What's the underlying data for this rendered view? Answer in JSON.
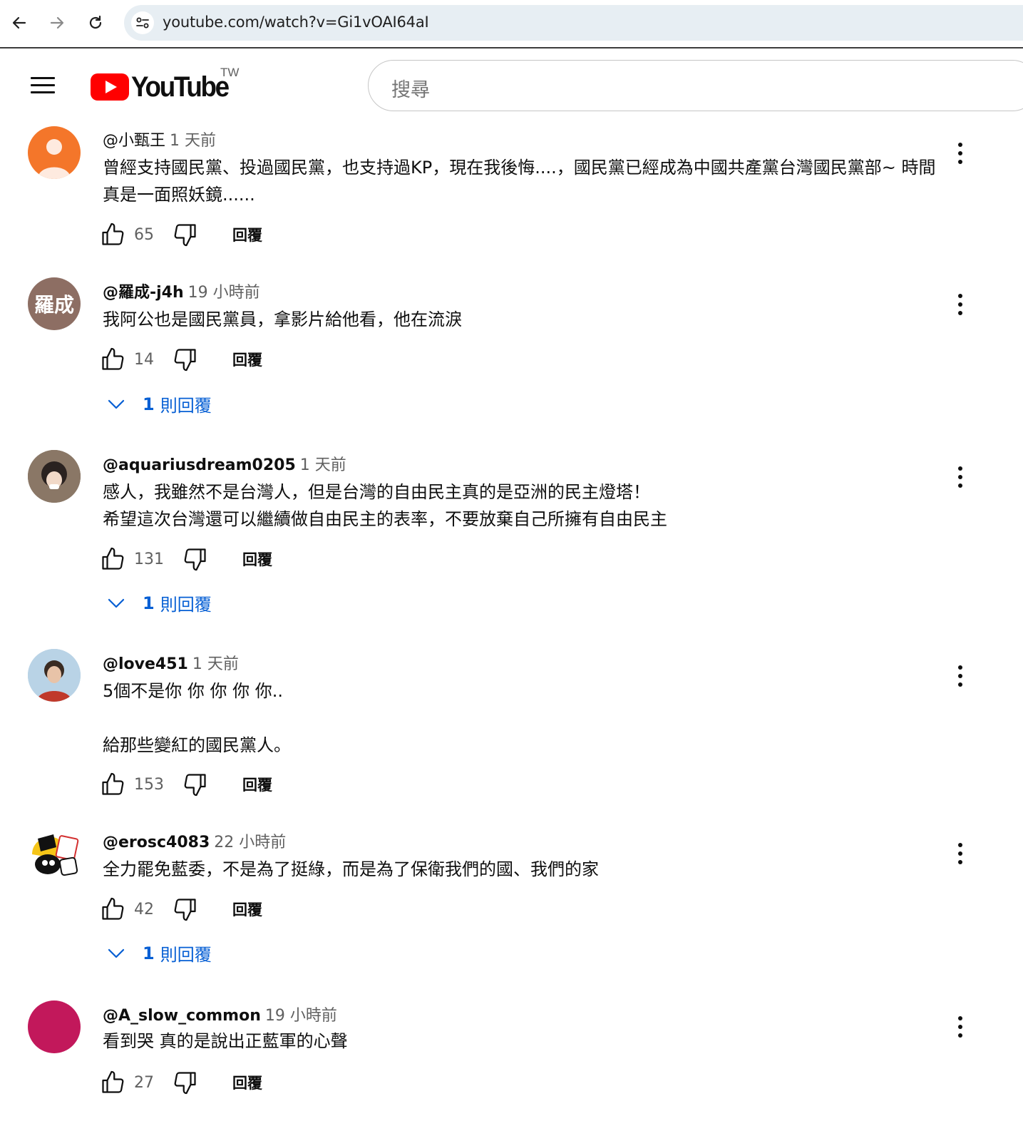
{
  "browser": {
    "url": "youtube.com/watch?v=Gi1vOAI64aI"
  },
  "masthead": {
    "logo_text": "YouTube",
    "region": "TW",
    "search_placeholder": "搜尋"
  },
  "comments": [
    {
      "author": "@小甄王",
      "time": "1 天前",
      "text": "曾經支持國民黨、投過國民黨，也支持過KP，現在我後悔....，國民黨已經成為中國共產黨台灣國民黨部~ 時間真是一面照妖鏡......",
      "likes": "65",
      "reply_label": "回覆",
      "avatar_color": "#f4762a"
    },
    {
      "author": "@羅成-j4h",
      "time": "19 小時前",
      "text": "我阿公也是國民黨員，拿影片給他看，他在流淚",
      "likes": "14",
      "reply_label": "回覆",
      "avatar_text": "羅成",
      "avatar_color": "#8d6e63",
      "replies_count": "1",
      "replies_label": "則回覆"
    },
    {
      "author": "@aquariusdream0205",
      "time": "1 天前",
      "text": "感人，我雖然不是台灣人，但是台灣的自由民主真的是亞洲的民主燈塔！\n希望這次台灣還可以繼續做自由民主的表率，不要放棄自己所擁有自由民主",
      "likes": "131",
      "reply_label": "回覆",
      "replies_count": "1",
      "replies_label": "則回覆"
    },
    {
      "author": "@love451",
      "time": "1 天前",
      "text": "5個不是你 你 你 你 你..\n\n給那些變紅的國民黨人。",
      "likes": "153",
      "reply_label": "回覆"
    },
    {
      "author": "@erosc4083",
      "time": "22 小時前",
      "text": "全力罷免藍委，不是為了挺綠，而是為了保衛我們的國、我們的家",
      "likes": "42",
      "reply_label": "回覆",
      "replies_count": "1",
      "replies_label": "則回覆"
    },
    {
      "author": "@A_slow_common",
      "time": "19 小時前",
      "text": "看到哭 真的是說出正藍軍的心聲",
      "likes": "27",
      "reply_label": "回覆",
      "avatar_color": "#c2185b"
    }
  ],
  "colors": {
    "link_blue": "#065fd4",
    "youtube_red": "#ff0000",
    "secondary_text": "#606060"
  }
}
